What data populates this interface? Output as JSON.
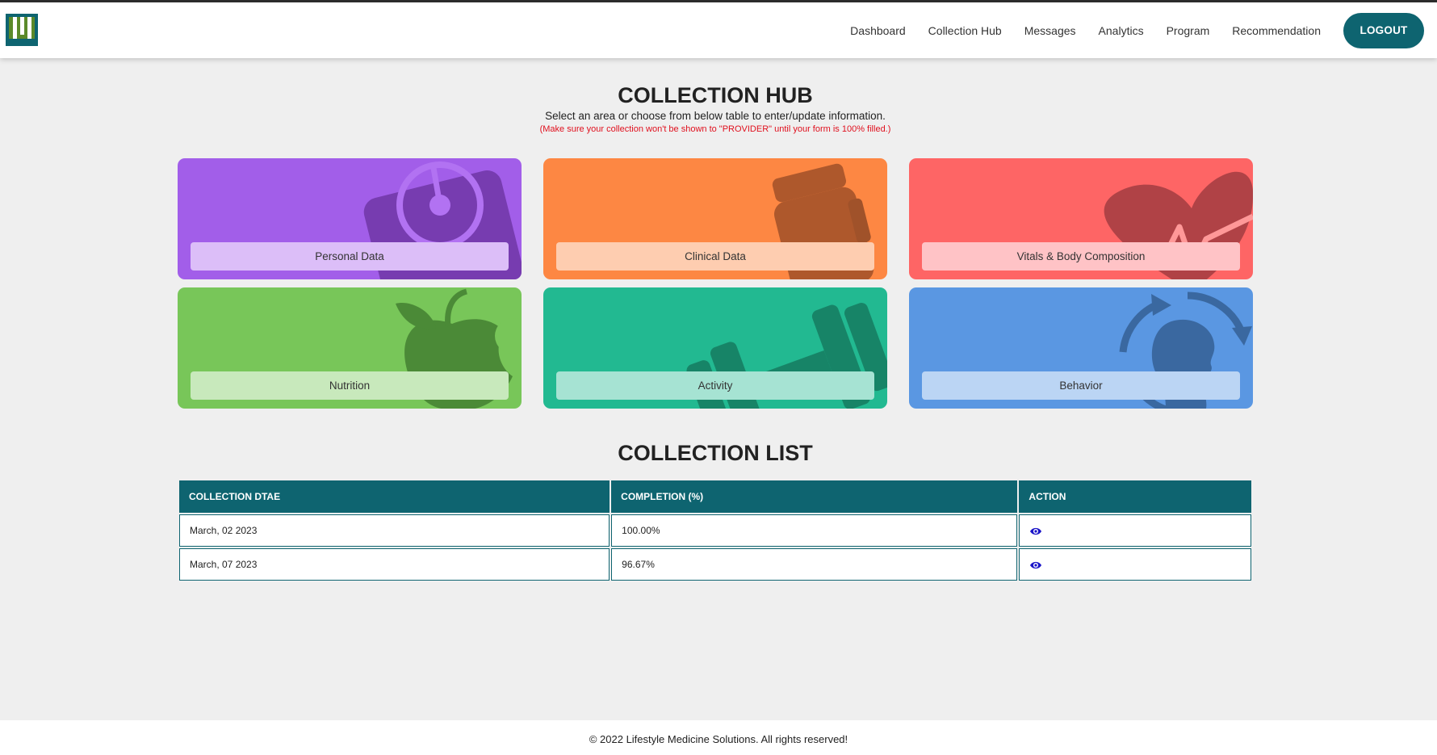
{
  "nav": {
    "items": [
      "Dashboard",
      "Collection Hub",
      "Messages",
      "Analytics",
      "Program",
      "Recommendation"
    ],
    "logout_label": "LOGOUT"
  },
  "hub": {
    "title": "COLLECTION HUB",
    "subtitle": "Select an area or choose from below table to enter/update information.",
    "note": "(Make sure your collection won't be shown to \"PROVIDER\" until your form is 100% filled.)"
  },
  "tiles": [
    {
      "label": "Personal Data",
      "icon": "scale-icon",
      "color": "#a25ee9"
    },
    {
      "label": "Clinical Data",
      "icon": "pill-bottle-icon",
      "color": "#fd8743"
    },
    {
      "label": "Vitals & Body Composition",
      "icon": "heart-pulse-icon",
      "color": "#fe6565"
    },
    {
      "label": "Nutrition",
      "icon": "apple-icon",
      "color": "#78c659"
    },
    {
      "label": "Activity",
      "icon": "dumbbell-icon",
      "color": "#22b991"
    },
    {
      "label": "Behavior",
      "icon": "head-cycle-icon",
      "color": "#5a97e2"
    }
  ],
  "list": {
    "title": "COLLECTION LIST",
    "headers": [
      "COLLECTION DTAE",
      "COMPLETION (%)",
      "ACTION"
    ],
    "rows": [
      {
        "date": "March, 02 2023",
        "completion": "100.00%",
        "action_icon": "eye-icon"
      },
      {
        "date": "March, 07 2023",
        "completion": "96.67%",
        "action_icon": "eye-icon"
      }
    ]
  },
  "footer": {
    "text": "© 2022 Lifestyle Medicine Solutions. All rights reserved!"
  },
  "colors": {
    "primary": "#0e6470",
    "note_red": "#e0101e"
  }
}
